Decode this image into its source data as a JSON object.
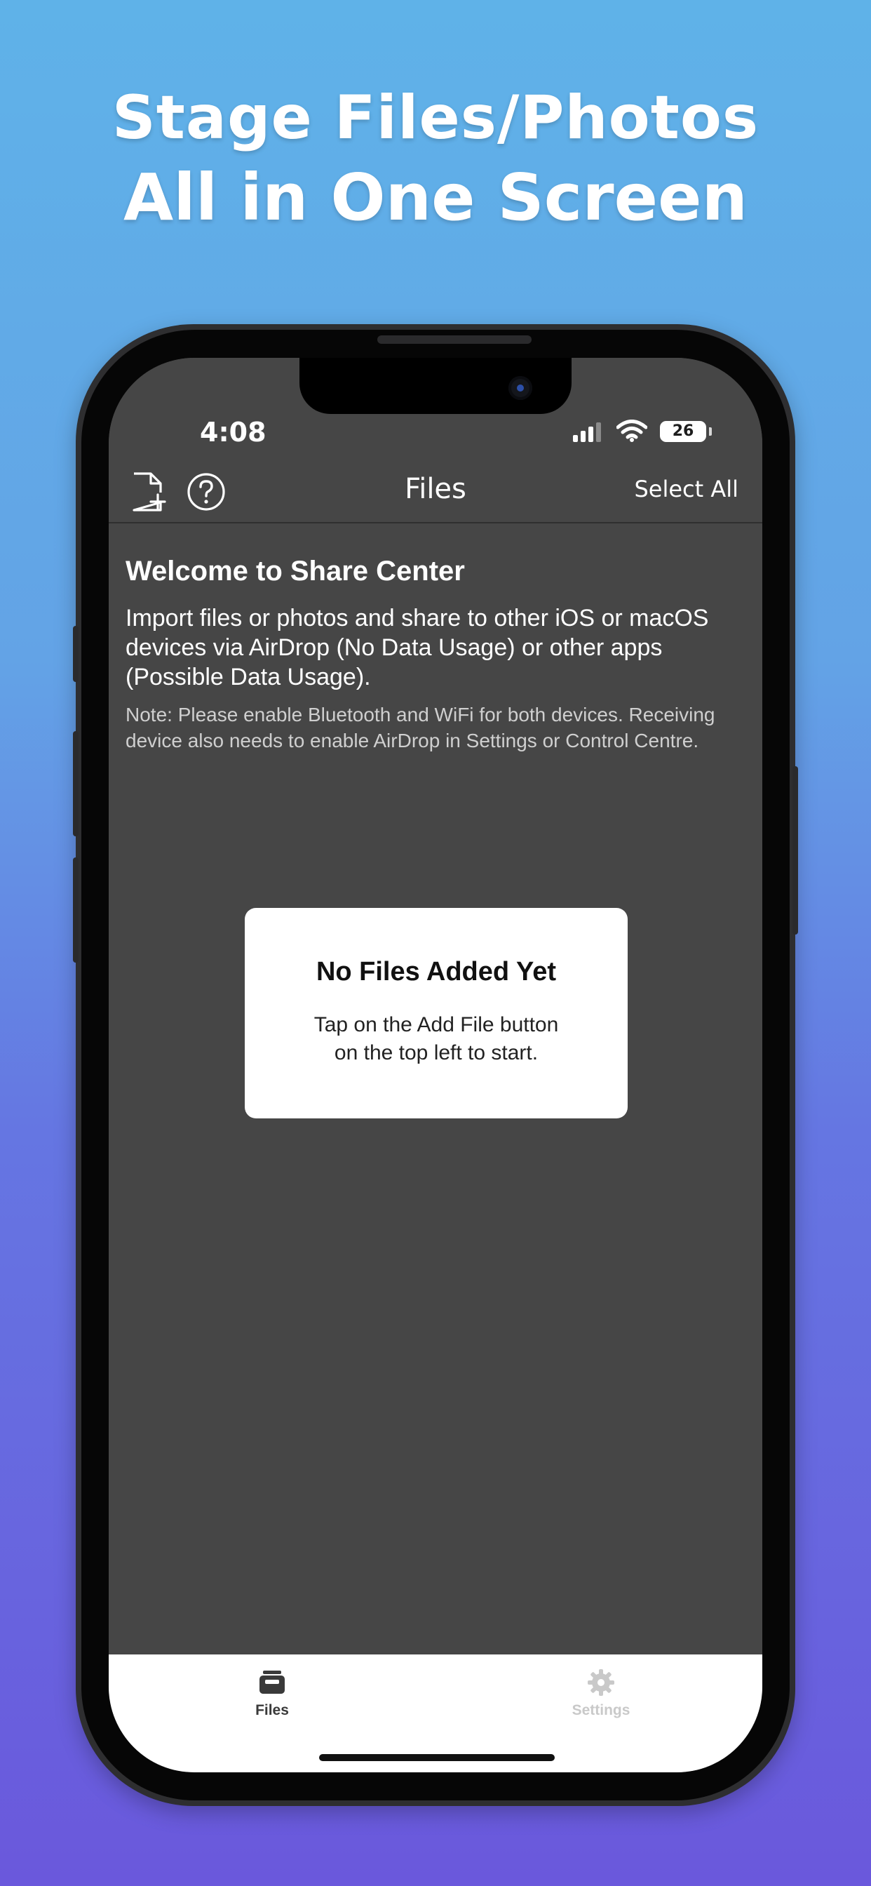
{
  "promo": {
    "line1": "Stage Files/Photos",
    "line2": "All in One Screen"
  },
  "status_bar": {
    "time": "4:08",
    "battery": "26"
  },
  "navbar": {
    "title": "Files",
    "select_all": "Select All",
    "left_icons": [
      "add-file-icon",
      "help-icon"
    ]
  },
  "welcome": {
    "title": "Welcome to Share Center",
    "body": "Import files or photos and share to other iOS or macOS devices via AirDrop (No Data Usage) or other apps (Possible Data Usage).",
    "note": "Note: Please enable Bluetooth and WiFi for both devices. Receiving device also needs to enable AirDrop in Settings or Control Centre."
  },
  "empty_state": {
    "title": "No Files Added Yet",
    "line1": "Tap on the Add File button",
    "line2": "on the top left to start."
  },
  "tabbar": {
    "tabs": [
      {
        "label": "Files",
        "icon": "tray-icon",
        "active": true
      },
      {
        "label": "Settings",
        "icon": "gear-icon",
        "active": false
      }
    ]
  },
  "colors": {
    "background_top": "#5fb2e8",
    "background_bottom": "#6a58dc",
    "screen_bg": "#464646"
  }
}
